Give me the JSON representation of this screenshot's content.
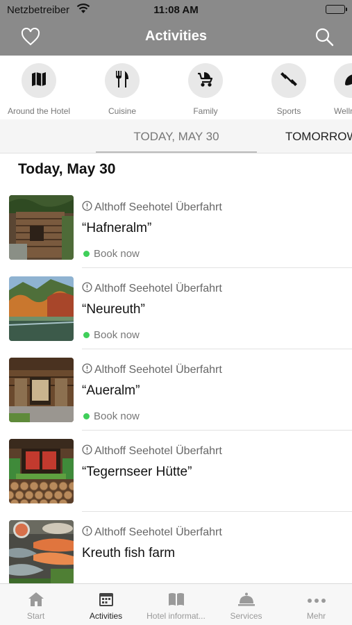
{
  "status": {
    "carrier": "Netzbetreiber",
    "time": "11:08 AM"
  },
  "nav": {
    "title": "Activities"
  },
  "categories": [
    {
      "label": "Around the Hotel",
      "icon": "map-icon"
    },
    {
      "label": "Cuisine",
      "icon": "fork-knife-icon"
    },
    {
      "label": "Family",
      "icon": "stroller-icon"
    },
    {
      "label": "Sports",
      "icon": "dumbbell-icon"
    },
    {
      "label": "Wellness",
      "icon": "leaf-icon"
    }
  ],
  "date_tabs": {
    "today": "TODAY, MAY 30",
    "tomorrow": "TOMORROW"
  },
  "section_title": "Today, May 30",
  "activities": [
    {
      "venue": "Althoff Seehotel Überfahrt",
      "name": "“Hafneralm”",
      "book": "Book now"
    },
    {
      "venue": "Althoff Seehotel Überfahrt",
      "name": "“Neureuth”",
      "book": "Book now"
    },
    {
      "venue": "Althoff Seehotel Überfahrt",
      "name": "“Aueralm”",
      "book": "Book now"
    },
    {
      "venue": "Althoff Seehotel Überfahrt",
      "name": "“Tegernseer Hütte”",
      "book": ""
    },
    {
      "venue": "Althoff Seehotel Überfahrt",
      "name": "Kreuth fish farm",
      "book": ""
    }
  ],
  "tab_bar": [
    {
      "label": "Start",
      "icon": "home-icon"
    },
    {
      "label": "Activities",
      "icon": "calendar-icon"
    },
    {
      "label": "Hotel informat...",
      "icon": "book-icon"
    },
    {
      "label": "Services",
      "icon": "service-bell-icon"
    },
    {
      "label": "Mehr",
      "icon": "more-icon"
    }
  ],
  "colors": {
    "header": "#8a8a8a",
    "book_dot": "#3fcf5a"
  }
}
